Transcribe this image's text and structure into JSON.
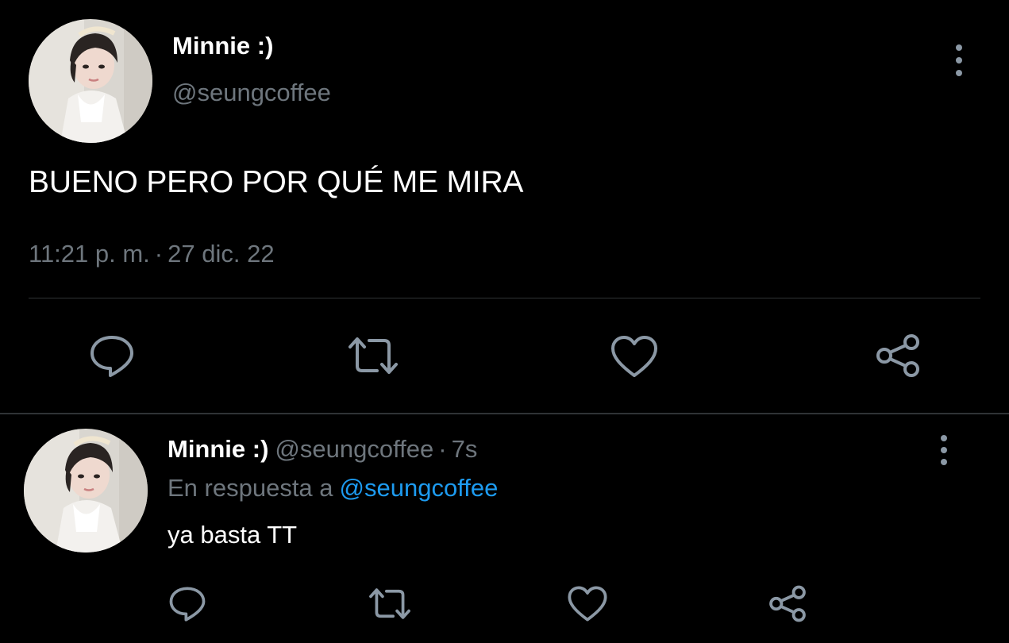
{
  "main_tweet": {
    "display_name": "Minnie :)",
    "handle": "@seungcoffee",
    "text": "BUENO PERO POR QUÉ ME MIRA",
    "time": "11:21 p. m.",
    "separator": "·",
    "date": "27 dic. 22",
    "more_icon": "more-vertical-icon"
  },
  "reply_tweet": {
    "display_name": "Minnie :)",
    "handle": "@seungcoffee",
    "separator": "·",
    "time_ago": "7s",
    "reply_prefix": "En respuesta a",
    "reply_mention": "@seungcoffee",
    "text": "ya basta TT",
    "more_icon": "more-vertical-icon"
  },
  "actions": [
    {
      "name": "reply",
      "icon": "comment-icon"
    },
    {
      "name": "retweet",
      "icon": "retweet-icon"
    },
    {
      "name": "like",
      "icon": "heart-icon"
    },
    {
      "name": "share",
      "icon": "share-icon"
    }
  ],
  "colors": {
    "background": "#000000",
    "primary_text": "#ffffff",
    "secondary_text": "#6e767d",
    "icon": "#8b98a5",
    "link": "#1d9bf0",
    "divider": "#2f3336"
  }
}
